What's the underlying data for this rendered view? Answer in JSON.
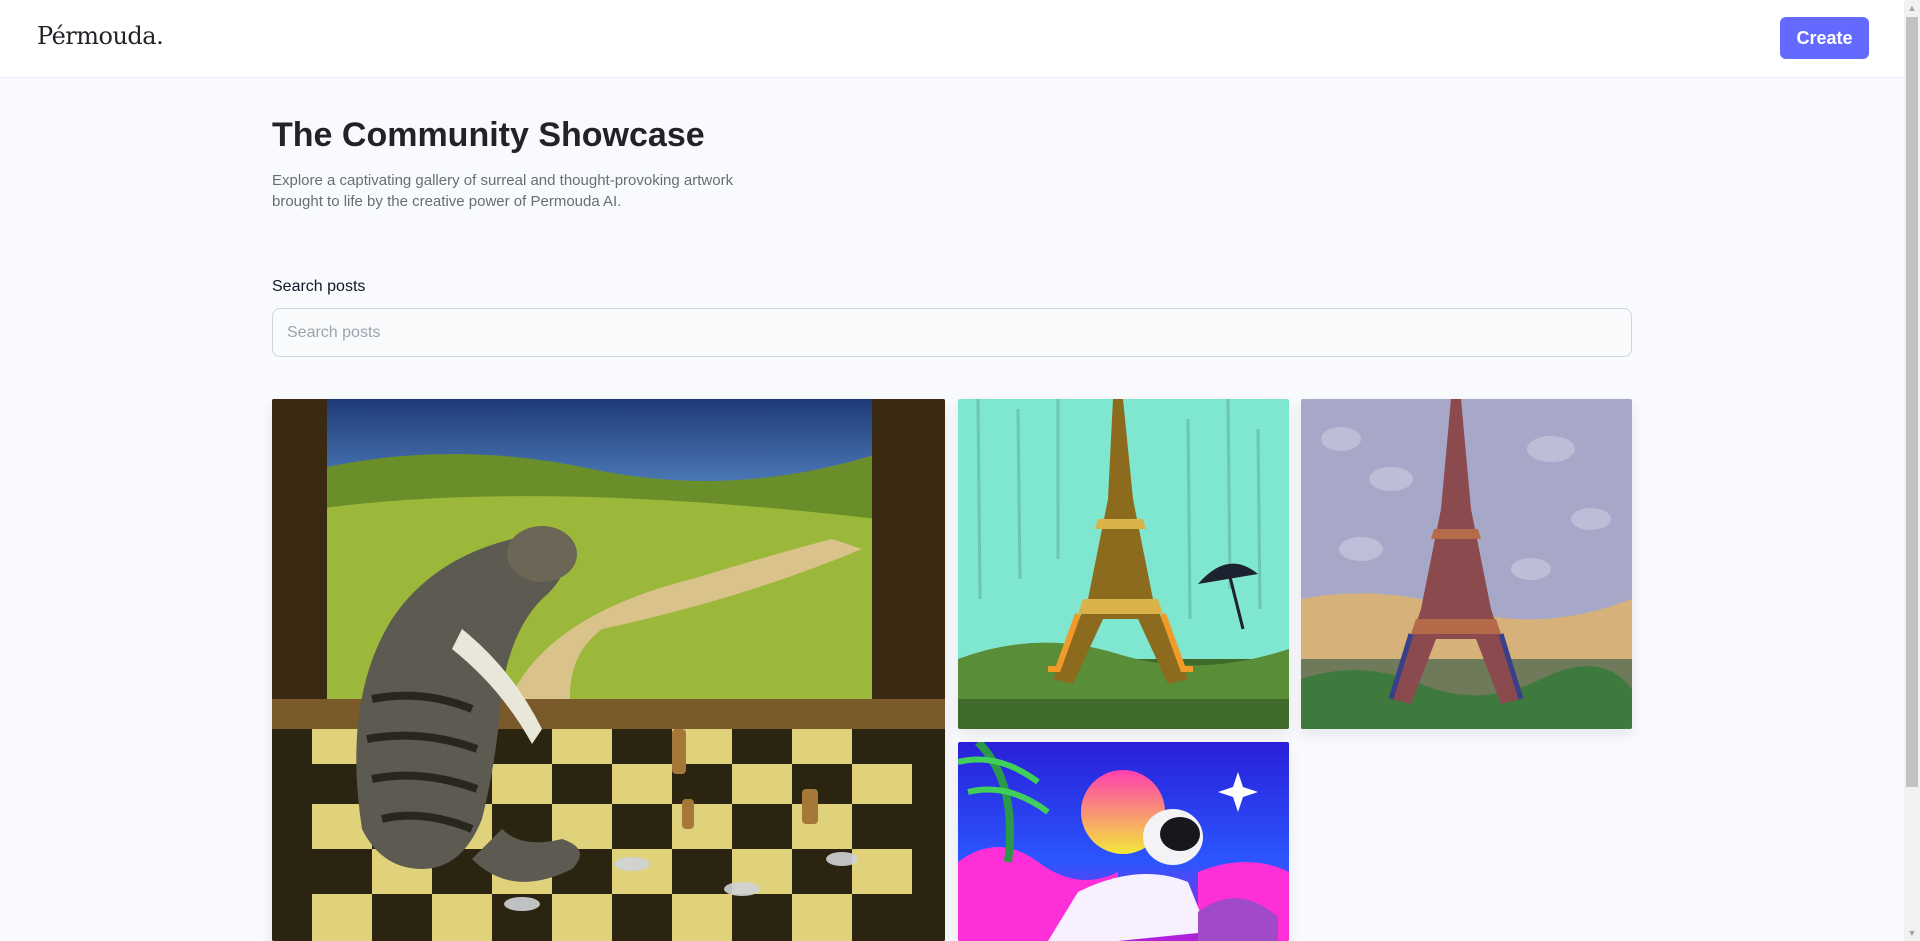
{
  "header": {
    "logo": "Pérmouda.",
    "create_label": "Create"
  },
  "main": {
    "title": "The Community Showcase",
    "subtitle": "Explore a captivating gallery of surreal and thought-provoking artwork brought to life by the creative power of Permouda AI."
  },
  "search": {
    "label": "Search posts",
    "placeholder": "Search posts",
    "value": ""
  },
  "colors": {
    "accent": "#6469ff",
    "title": "#222328",
    "subtitle": "#666e75",
    "background": "#f9fafe"
  }
}
